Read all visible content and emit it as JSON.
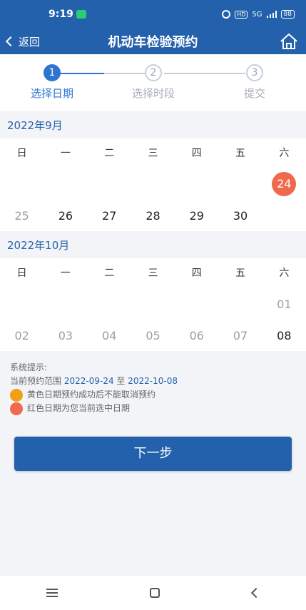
{
  "status_bar": {
    "time": "9:19",
    "network": "5G",
    "battery": "88"
  },
  "nav": {
    "back_label": "返回",
    "title": "机动车检验预约"
  },
  "steps": [
    {
      "num": "1",
      "label": "选择日期",
      "state": "active"
    },
    {
      "num": "2",
      "label": "选择时段",
      "state": "inactive"
    },
    {
      "num": "3",
      "label": "提交",
      "state": "inactive"
    }
  ],
  "weekdays": [
    "日",
    "一",
    "二",
    "三",
    "四",
    "五",
    "六"
  ],
  "months": [
    {
      "title": "2022年9月",
      "weeks": [
        [
          {
            "day": "",
            "style": "empty"
          },
          {
            "day": "",
            "style": "empty"
          },
          {
            "day": "",
            "style": "empty"
          },
          {
            "day": "",
            "style": "empty"
          },
          {
            "day": "",
            "style": "empty"
          },
          {
            "day": "",
            "style": "empty"
          },
          {
            "day": "24",
            "style": "selected"
          }
        ],
        [
          {
            "day": "25",
            "style": "gray"
          },
          {
            "day": "26",
            "style": "normal"
          },
          {
            "day": "27",
            "style": "normal"
          },
          {
            "day": "28",
            "style": "normal"
          },
          {
            "day": "29",
            "style": "normal"
          },
          {
            "day": "30",
            "style": "normal"
          },
          {
            "day": "",
            "style": "empty"
          }
        ]
      ]
    },
    {
      "title": "2022年10月",
      "weeks": [
        [
          {
            "day": "",
            "style": "empty"
          },
          {
            "day": "",
            "style": "empty"
          },
          {
            "day": "",
            "style": "empty"
          },
          {
            "day": "",
            "style": "empty"
          },
          {
            "day": "",
            "style": "empty"
          },
          {
            "day": "",
            "style": "empty"
          },
          {
            "day": "01",
            "style": "gray"
          }
        ],
        [
          {
            "day": "02",
            "style": "gray"
          },
          {
            "day": "03",
            "style": "gray"
          },
          {
            "day": "04",
            "style": "gray"
          },
          {
            "day": "05",
            "style": "gray"
          },
          {
            "day": "06",
            "style": "gray"
          },
          {
            "day": "07",
            "style": "gray"
          },
          {
            "day": "08",
            "style": "normal"
          }
        ]
      ]
    }
  ],
  "tips": {
    "title": "系统提示:",
    "range_prefix": "当前预约范围",
    "range_start": "2022-09-24",
    "range_sep": "至",
    "range_end": "2022-10-08",
    "legend_yellow": "黄色日期预约成功后不能取消预约",
    "legend_red": "红色日期为您当前选中日期"
  },
  "next_button": "下一步",
  "colors": {
    "primary": "#2461ac",
    "step_active": "#2f74d0",
    "selected_red": "#ef6a4c",
    "yellow": "#f0a018"
  }
}
